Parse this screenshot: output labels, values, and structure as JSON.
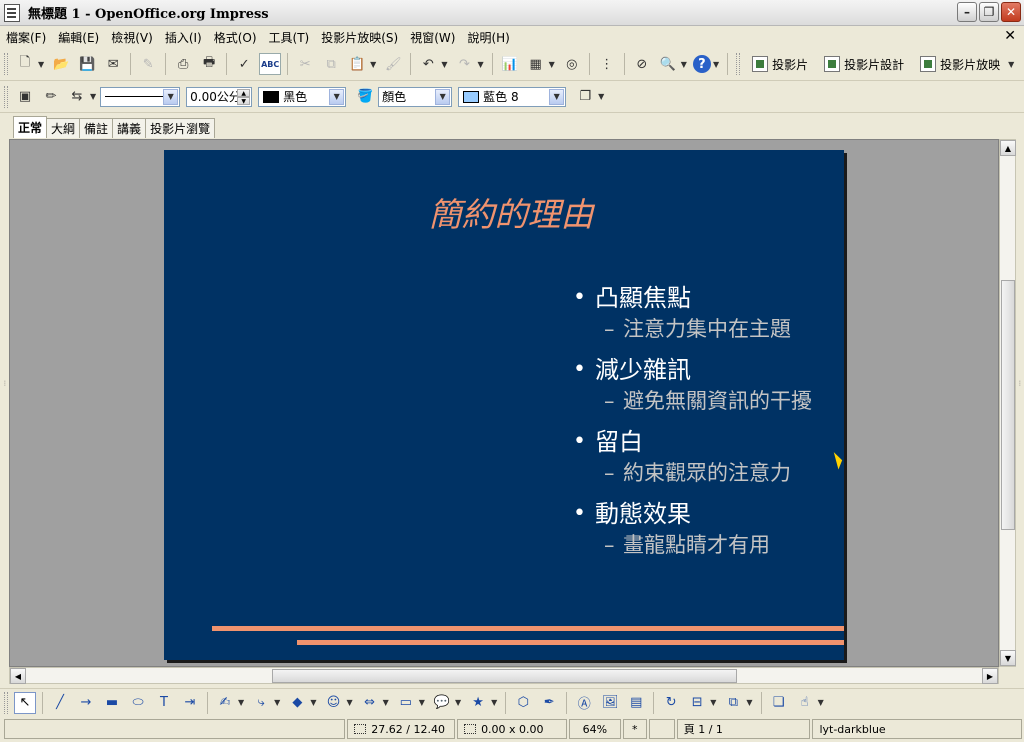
{
  "window": {
    "title": "無標題 1 - OpenOffice.org Impress"
  },
  "menu": {
    "items": [
      "檔案(F)",
      "編輯(E)",
      "檢視(V)",
      "插入(I)",
      "格式(O)",
      "工具(T)",
      "投影片放映(S)",
      "視窗(W)",
      "說明(H)"
    ]
  },
  "toolbar": {
    "spell_label": "ABC",
    "slide_label": "投影片",
    "design_label": "投影片設計",
    "show_label": "投影片放映"
  },
  "lineprops": {
    "line_width": "0.00公分",
    "line_color": "黑色",
    "line_color_hex": "#000000",
    "fill_type": "顏色",
    "fill_color": "藍色 8",
    "fill_color_hex": "#99ccff"
  },
  "view_tabs": [
    "正常",
    "大綱",
    "備註",
    "講義",
    "投影片瀏覽"
  ],
  "slide": {
    "title": "簡約的理由",
    "bullets": [
      {
        "main": "凸顯焦點",
        "sub": "注意力集中在主題"
      },
      {
        "main": "減少雜訊",
        "sub": "避免無關資訊的干擾"
      },
      {
        "main": "留白",
        "sub": "約束觀眾的注意力"
      },
      {
        "main": "動態效果",
        "sub": "畫龍點睛才有用"
      }
    ],
    "background_color": "#003264",
    "accent_color": "#f0936e"
  },
  "status": {
    "position": "27.62 / 12.40",
    "size": "0.00 x 0.00",
    "zoom": "64%",
    "modified": "*",
    "page": "頁 1 / 1",
    "layout": "lyt-darkblue"
  }
}
